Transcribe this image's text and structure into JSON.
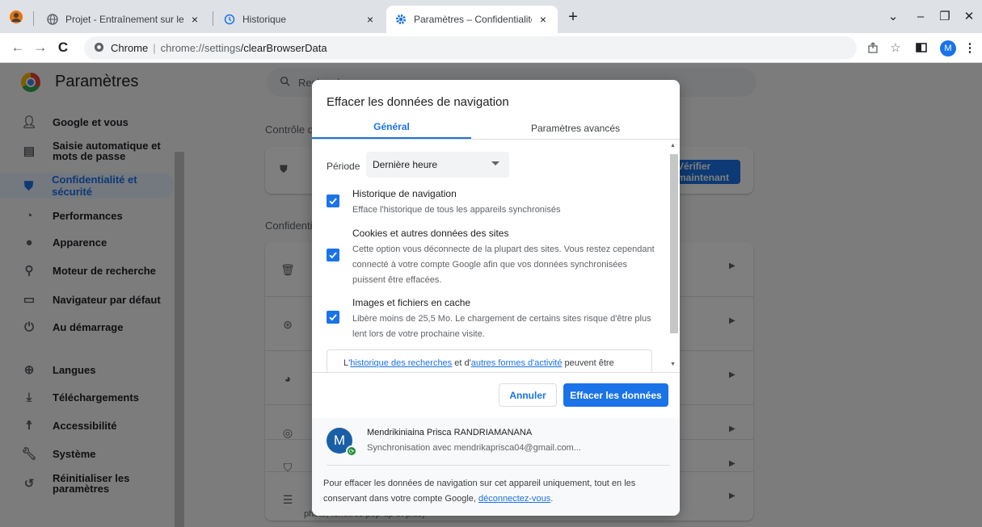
{
  "browser": {
    "tabs": [
      {
        "label": "Projet - Entraînement sur les bases",
        "close": "×"
      },
      {
        "label": "Historique",
        "close": "×"
      },
      {
        "label": "Paramètres – Confidentialité et sécurité",
        "close": "×"
      }
    ],
    "new_tab": "+",
    "window_controls": {
      "minimize": "–",
      "maximize": "❐",
      "close": "✕",
      "tab_search": "⌄"
    },
    "omnibox": {
      "site_label": "Chrome",
      "url_host": "chrome://settings",
      "url_path": "/clearBrowserData"
    },
    "avatar_letter": "M"
  },
  "settings": {
    "title": "Paramètres",
    "search_placeholder": "Rechercher",
    "sidebar": [
      {
        "label": "Google et vous",
        "icon": "person-icon"
      },
      {
        "label": "Saisie automatique et mots de passe",
        "icon": "clipboard-icon"
      },
      {
        "label": "Confidentialité et sécurité",
        "icon": "shield-icon",
        "active": true
      },
      {
        "label": "Performances",
        "icon": "gauge-icon"
      },
      {
        "label": "Apparence",
        "icon": "palette-icon"
      },
      {
        "label": "Moteur de recherche",
        "icon": "search-icon"
      },
      {
        "label": "Navigateur par défaut",
        "icon": "browser-icon"
      },
      {
        "label": "Au démarrage",
        "icon": "power-icon"
      },
      {
        "label": "Langues",
        "icon": "globe-icon"
      },
      {
        "label": "Téléchargements",
        "icon": "download-icon"
      },
      {
        "label": "Accessibilité",
        "icon": "accessibility-icon"
      },
      {
        "label": "Système",
        "icon": "wrench-icon"
      },
      {
        "label": "Réinitialiser les paramètres",
        "icon": "reset-icon"
      }
    ],
    "section_safety": "Contrôle de sécurité",
    "section_privacy": "Confidentialité et sécurité",
    "check_now_button": "Vérifier maintenant",
    "privacy_row_last_sub": "photo, fenêtres pop-up et plus)"
  },
  "dialog": {
    "title": "Effacer les données de navigation",
    "tabs": [
      {
        "label": "Général",
        "active": true
      },
      {
        "label": "Paramètres avancés",
        "active": false
      }
    ],
    "period_label": "Période",
    "period_value": "Dernière heure",
    "options": [
      {
        "title": "Historique de navigation",
        "desc": "Efface l'historique de tous les appareils synchronisés",
        "checked": true
      },
      {
        "title": "Cookies et autres données des sites",
        "desc": "Cette option vous déconnecte de la plupart des sites. Vous restez cependant connecté à votre compte Google afin que vos données synchronisées puissent être effacées.",
        "checked": true
      },
      {
        "title": "Images et fichiers en cache",
        "desc": "Libère moins de 25,5 Mo. Le chargement de certains sites risque d'être plus lent lors de votre prochaine visite.",
        "checked": true
      }
    ],
    "info": {
      "prefix": "L'",
      "link1": "historique des recherches",
      "middle": " et d'",
      "link2": "autres formes d'activité",
      "suffix": " peuvent être"
    },
    "cancel_button": "Annuler",
    "clear_button": "Effacer les données",
    "account": {
      "initial": "M",
      "name": "Mendrikiniaina Prisca RANDRIAMANANA",
      "sync": "Synchronisation avec mendrikaprisca04@gmail.com..."
    },
    "footer": {
      "text": "Pour effacer les données de navigation sur cet appareil uniquement, tout en les conservant dans votre compte Google, ",
      "link": "déconnectez-vous",
      "end": "."
    }
  }
}
